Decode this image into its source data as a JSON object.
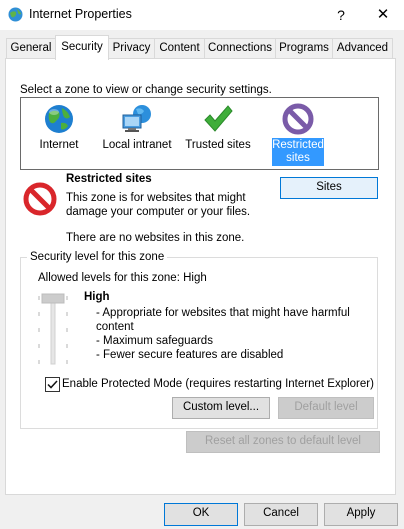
{
  "window": {
    "title": "Internet Properties",
    "help_label": "?",
    "close_label": "✕"
  },
  "tabs": [
    {
      "label": "General"
    },
    {
      "label": "Security"
    },
    {
      "label": "Privacy"
    },
    {
      "label": "Content"
    },
    {
      "label": "Connections"
    },
    {
      "label": "Programs"
    },
    {
      "label": "Advanced"
    }
  ],
  "active_tab": "Security",
  "zones": {
    "prompt": "Select a zone to view or change security settings.",
    "items": [
      {
        "label": "Internet",
        "icon": "globe-icon"
      },
      {
        "label": "Local intranet",
        "icon": "intranet-icon"
      },
      {
        "label": "Trusted sites",
        "icon": "checkmark-icon"
      },
      {
        "label": "Restricted sites",
        "icon": "restricted-icon",
        "selected": true
      }
    ],
    "selected_name": "Restricted sites",
    "description": "This zone is for websites that might damage your computer or your files.",
    "no_sites": "There are no websites in this zone.",
    "sites_button": "Sites"
  },
  "security_level": {
    "group_title": "Security level for this zone",
    "allowed": "Allowed levels for this zone: High",
    "level": "High",
    "bullets": [
      "- Appropriate for websites that might have harmful content",
      "- Maximum safeguards",
      "- Fewer secure features are disabled"
    ],
    "protected_mode_label": "Enable Protected Mode (requires restarting Internet Explorer)",
    "protected_mode_checked": true,
    "custom_level_button": "Custom level...",
    "default_level_button": "Default level"
  },
  "reset_button": "Reset all zones to default level",
  "footer": {
    "ok": "OK",
    "cancel": "Cancel",
    "apply": "Apply"
  }
}
